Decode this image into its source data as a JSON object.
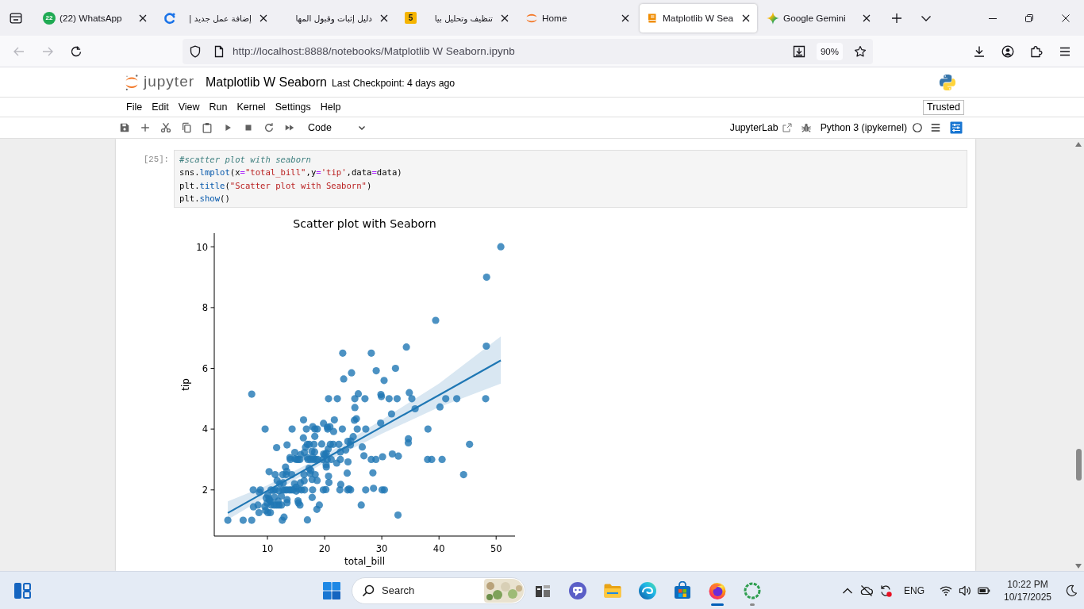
{
  "browser": {
    "tabs": [
      {
        "title": "(22) WhatsApp",
        "kind": "badge",
        "favicon_text": "22",
        "selected": false
      },
      {
        "title": "إضافة عمل جديد |",
        "kind": "ring",
        "selected": false
      },
      {
        "title": "دليل إثبات وقبول المها",
        "kind": "plain",
        "selected": false
      },
      {
        "title": "تنظيف وتحليل بيا",
        "kind": "tile",
        "favicon_text": "5",
        "selected": false
      },
      {
        "title": "Home",
        "kind": "arcs",
        "selected": false
      },
      {
        "title": "Matplotlib W Sea",
        "kind": "book",
        "selected": true
      },
      {
        "title": "Google Gemini",
        "kind": "sparkle",
        "selected": false
      }
    ],
    "back_disabled": true,
    "forward_disabled": true,
    "url": "http://localhost:8888/notebooks/Matplotlib W Seaborn.ipynb",
    "zoom": "90%"
  },
  "jupyter": {
    "logo_text": "jupyter",
    "title": "Matplotlib W Seaborn",
    "checkpoint": "Last Checkpoint: 4 days ago",
    "menu": [
      "File",
      "Edit",
      "View",
      "Run",
      "Kernel",
      "Settings",
      "Help"
    ],
    "trusted": "Trusted",
    "cell_type": "Code",
    "lab_link": "JupyterLab",
    "kernel": {
      "name": "Python 3 (ipykernel)",
      "busy": false
    }
  },
  "cell": {
    "prompt": "[25]:",
    "lines": [
      [
        {
          "text": "#scatter plot with seaborn",
          "kind": "comment"
        }
      ],
      [
        {
          "text": "sns.",
          "kind": "plain"
        },
        {
          "text": "lmplot",
          "kind": "property"
        },
        {
          "text": "(x",
          "kind": "plain"
        },
        {
          "text": "=",
          "kind": "operator"
        },
        {
          "text": "\"total_bill\"",
          "kind": "string"
        },
        {
          "text": ",y",
          "kind": "plain"
        },
        {
          "text": "=",
          "kind": "operator"
        },
        {
          "text": "'tip'",
          "kind": "string"
        },
        {
          "text": ",data",
          "kind": "plain"
        },
        {
          "text": "=",
          "kind": "operator"
        },
        {
          "text": "data)",
          "kind": "plain"
        }
      ],
      [
        {
          "text": "plt.",
          "kind": "plain"
        },
        {
          "text": "title",
          "kind": "property"
        },
        {
          "text": "(",
          "kind": "plain"
        },
        {
          "text": "\"Scatter plot with Seaborn\"",
          "kind": "string"
        },
        {
          "text": ")",
          "kind": "plain"
        }
      ],
      [
        {
          "text": "plt.",
          "kind": "plain"
        },
        {
          "text": "show",
          "kind": "property"
        },
        {
          "text": "()",
          "kind": "plain"
        }
      ]
    ],
    "output": {
      "chart_data": [
        {
          "type": "scatter",
          "title": "Scatter plot with Seaborn",
          "xlabel": "total_bill",
          "ylabel": "tip",
          "xlim": [
            0.7,
            53.3
          ],
          "ylim": [
            0.48,
            10.45
          ],
          "xticks": [
            10,
            20,
            30,
            40,
            50
          ],
          "yticks": [
            2,
            4,
            6,
            8,
            10
          ],
          "series": [
            {
              "color": "#1f77b4",
              "x": [
                16.99,
                10.34,
                21.01,
                23.68,
                24.59,
                25.29,
                8.77,
                26.88,
                15.04,
                14.78,
                10.27,
                35.26,
                15.42,
                18.43,
                14.83,
                21.58,
                16.29,
                16.97,
                20.65,
                17.92,
                20.29,
                15.77,
                39.42,
                19.82,
                17.81,
                13.37,
                12.69,
                21.7,
                19.65,
                9.55,
                18.35,
                15.06,
                20.69,
                17.78,
                24.06,
                16.93,
                18.69,
                31.27,
                17.46,
                13.94,
                9.68,
                30.4,
                22.23,
                32.4,
                28.55,
                18.04,
                10.29,
                34.81,
                9.94,
                25.56,
                19.49,
                38.01,
                26.41,
                11.24,
                48.27,
                20.29,
                13.81,
                11.02,
                18.29,
                17.59,
                20.08,
                3.07,
                20.23,
                15.01,
                12.02,
                17.07,
                25.28,
                14.73,
                10.51,
                17.92,
                27.2,
                22.76,
                17.29,
                16.66,
                10.07,
                32.68,
                13.03,
                18.28,
                24.71,
                21.16,
                28.97,
                22.49,
                5.75,
                16.32,
                22.75,
                40.17,
                12.03,
                12.46,
                11.35,
                15.38,
                44.3,
                20.92,
                15.36,
                20.49,
                25.21,
                14.31,
                14.0,
                7.25,
                38.07,
                23.95,
                25.71,
                17.31,
                29.93,
                10.65,
                12.43,
                24.08,
                11.69,
                13.42,
                14.26,
                15.95,
                29.8,
                11.38,
                22.82,
                19.08,
                20.27,
                11.17,
                18.26,
                8.51,
                14.15,
                13.16,
                34.3,
                41.19,
                27.05,
                16.43,
                8.35,
                18.64,
                11.87,
                9.78,
                7.51,
                24.55,
                19.77,
                29.85,
                48.17,
                25.0,
                13.39,
                16.49,
                21.5,
                12.66,
                17.51,
                24.52,
                20.76,
                31.71,
                10.59,
                10.63,
                50.81,
                15.81,
                7.25,
                31.85,
                16.82,
                32.9,
                17.89,
                14.48,
                9.6,
                34.63,
                34.65,
                23.33,
                45.35,
                23.17,
                40.55,
                20.69,
                30.46,
                18.15,
                23.1,
                15.69,
                19.81,
                28.44,
                15.48,
                7.56,
                43.11,
                18.71,
                16.4,
                20.53,
                16.47,
                26.59,
                38.73,
                24.27,
                12.76,
                30.06,
                25.89,
                48.33,
                13.27,
                28.17,
                12.9,
                28.15,
                11.59,
                30.14,
                12.16,
                13.42,
                8.58,
                13.42,
                20.45,
                22.12,
                24.01,
                15.69,
                11.61,
                10.07,
                12.6,
                32.83,
                35.83,
                29.03,
                27.18,
                22.67,
                17.82,
                18.78
              ],
              "values": [
                1.01,
                1.66,
                3.5,
                3.31,
                3.61,
                4.71,
                2.0,
                3.12,
                1.96,
                3.23,
                1.71,
                5.0,
                1.57,
                3.0,
                3.02,
                3.92,
                3.71,
                3.5,
                3.35,
                4.08,
                2.75,
                2.23,
                7.58,
                3.18,
                2.34,
                2.0,
                2.0,
                4.3,
                3.0,
                1.45,
                2.5,
                3.0,
                2.45,
                3.27,
                3.6,
                3.07,
                2.31,
                5.0,
                2.54,
                3.06,
                1.32,
                5.6,
                5.0,
                6.0,
                2.05,
                3.0,
                2.6,
                5.2,
                1.56,
                4.34,
                3.51,
                3.0,
                1.5,
                1.76,
                6.73,
                3.21,
                2.0,
                1.98,
                3.76,
                2.64,
                3.15,
                1.0,
                2.01,
                2.09,
                1.97,
                3.0,
                5.0,
                2.2,
                1.25,
                3.08,
                4.0,
                3.0,
                2.71,
                3.4,
                1.83,
                5.0,
                2.0,
                4.0,
                5.85,
                3.0,
                3.0,
                3.5,
                1.0,
                4.3,
                3.25,
                4.73,
                1.5,
                1.5,
                2.5,
                3.0,
                2.5,
                4.08,
                1.64,
                4.06,
                4.29,
                4.0,
                3.0,
                1.0,
                4.0,
                2.55,
                4.0,
                3.5,
                5.07,
                1.5,
                1.8,
                2.92,
                2.31,
                1.68,
                2.5,
                2.0,
                4.2,
                2.0,
                2.18,
                1.5,
                2.83,
                1.5,
                3.25,
                1.25,
                2.0,
                2.75,
                6.7,
                5.0,
                5.0,
                2.3,
                1.5,
                1.36,
                1.63,
                1.73,
                2.0,
                2.0,
                2.0,
                5.14,
                5.0,
                3.75,
                2.61,
                2.0,
                3.5,
                2.5,
                3.0,
                3.48,
                2.24,
                4.5,
                1.61,
                2.0,
                10.0,
                3.16,
                5.15,
                3.18,
                4.0,
                3.11,
                2.0,
                2.0,
                4.0,
                3.55,
                3.68,
                5.65,
                3.5,
                6.5,
                3.0,
                5.0,
                2.0,
                3.5,
                4.0,
                1.5,
                4.19,
                2.56,
                2.02,
                1.44,
                5.0,
                4.0,
                2.5,
                4.0,
                3.23,
                3.41,
                3.0,
                2.03,
                2.23,
                2.0,
                5.16,
                9.0,
                2.5,
                6.5,
                1.1,
                3.0,
                1.5,
                3.09,
                2.2,
                3.48,
                1.92,
                1.58,
                3.0,
                2.88,
                2.0,
                3.0,
                3.39,
                1.25,
                1.0,
                1.17,
                4.67,
                5.92,
                2.0,
                2.0,
                1.75,
                3.0
              ]
            },
            {
              "type": "line",
              "color": "#1f77b4",
              "x": [
                3.07,
                10,
                20,
                30,
                40,
                50.81
              ],
              "values": [
                1.24,
                1.97,
                3.02,
                4.07,
                5.12,
                6.26
              ]
            }
          ]
        }
      ]
    }
  },
  "taskbar": {
    "search": {
      "placeholder": "Search"
    },
    "apps": [
      {
        "kind": "tiles",
        "open": false,
        "active": false
      },
      {
        "kind": "chat",
        "open": false,
        "active": false
      },
      {
        "kind": "folder",
        "open": false,
        "active": false
      },
      {
        "kind": "swirl",
        "open": false,
        "active": false
      },
      {
        "kind": "bag",
        "open": false,
        "active": false
      },
      {
        "kind": "flame",
        "open": true,
        "active": true
      },
      {
        "kind": "ring",
        "open": true,
        "active": false
      }
    ],
    "language": "ENG",
    "time": "10:22 PM",
    "date": "10/17/2025"
  }
}
